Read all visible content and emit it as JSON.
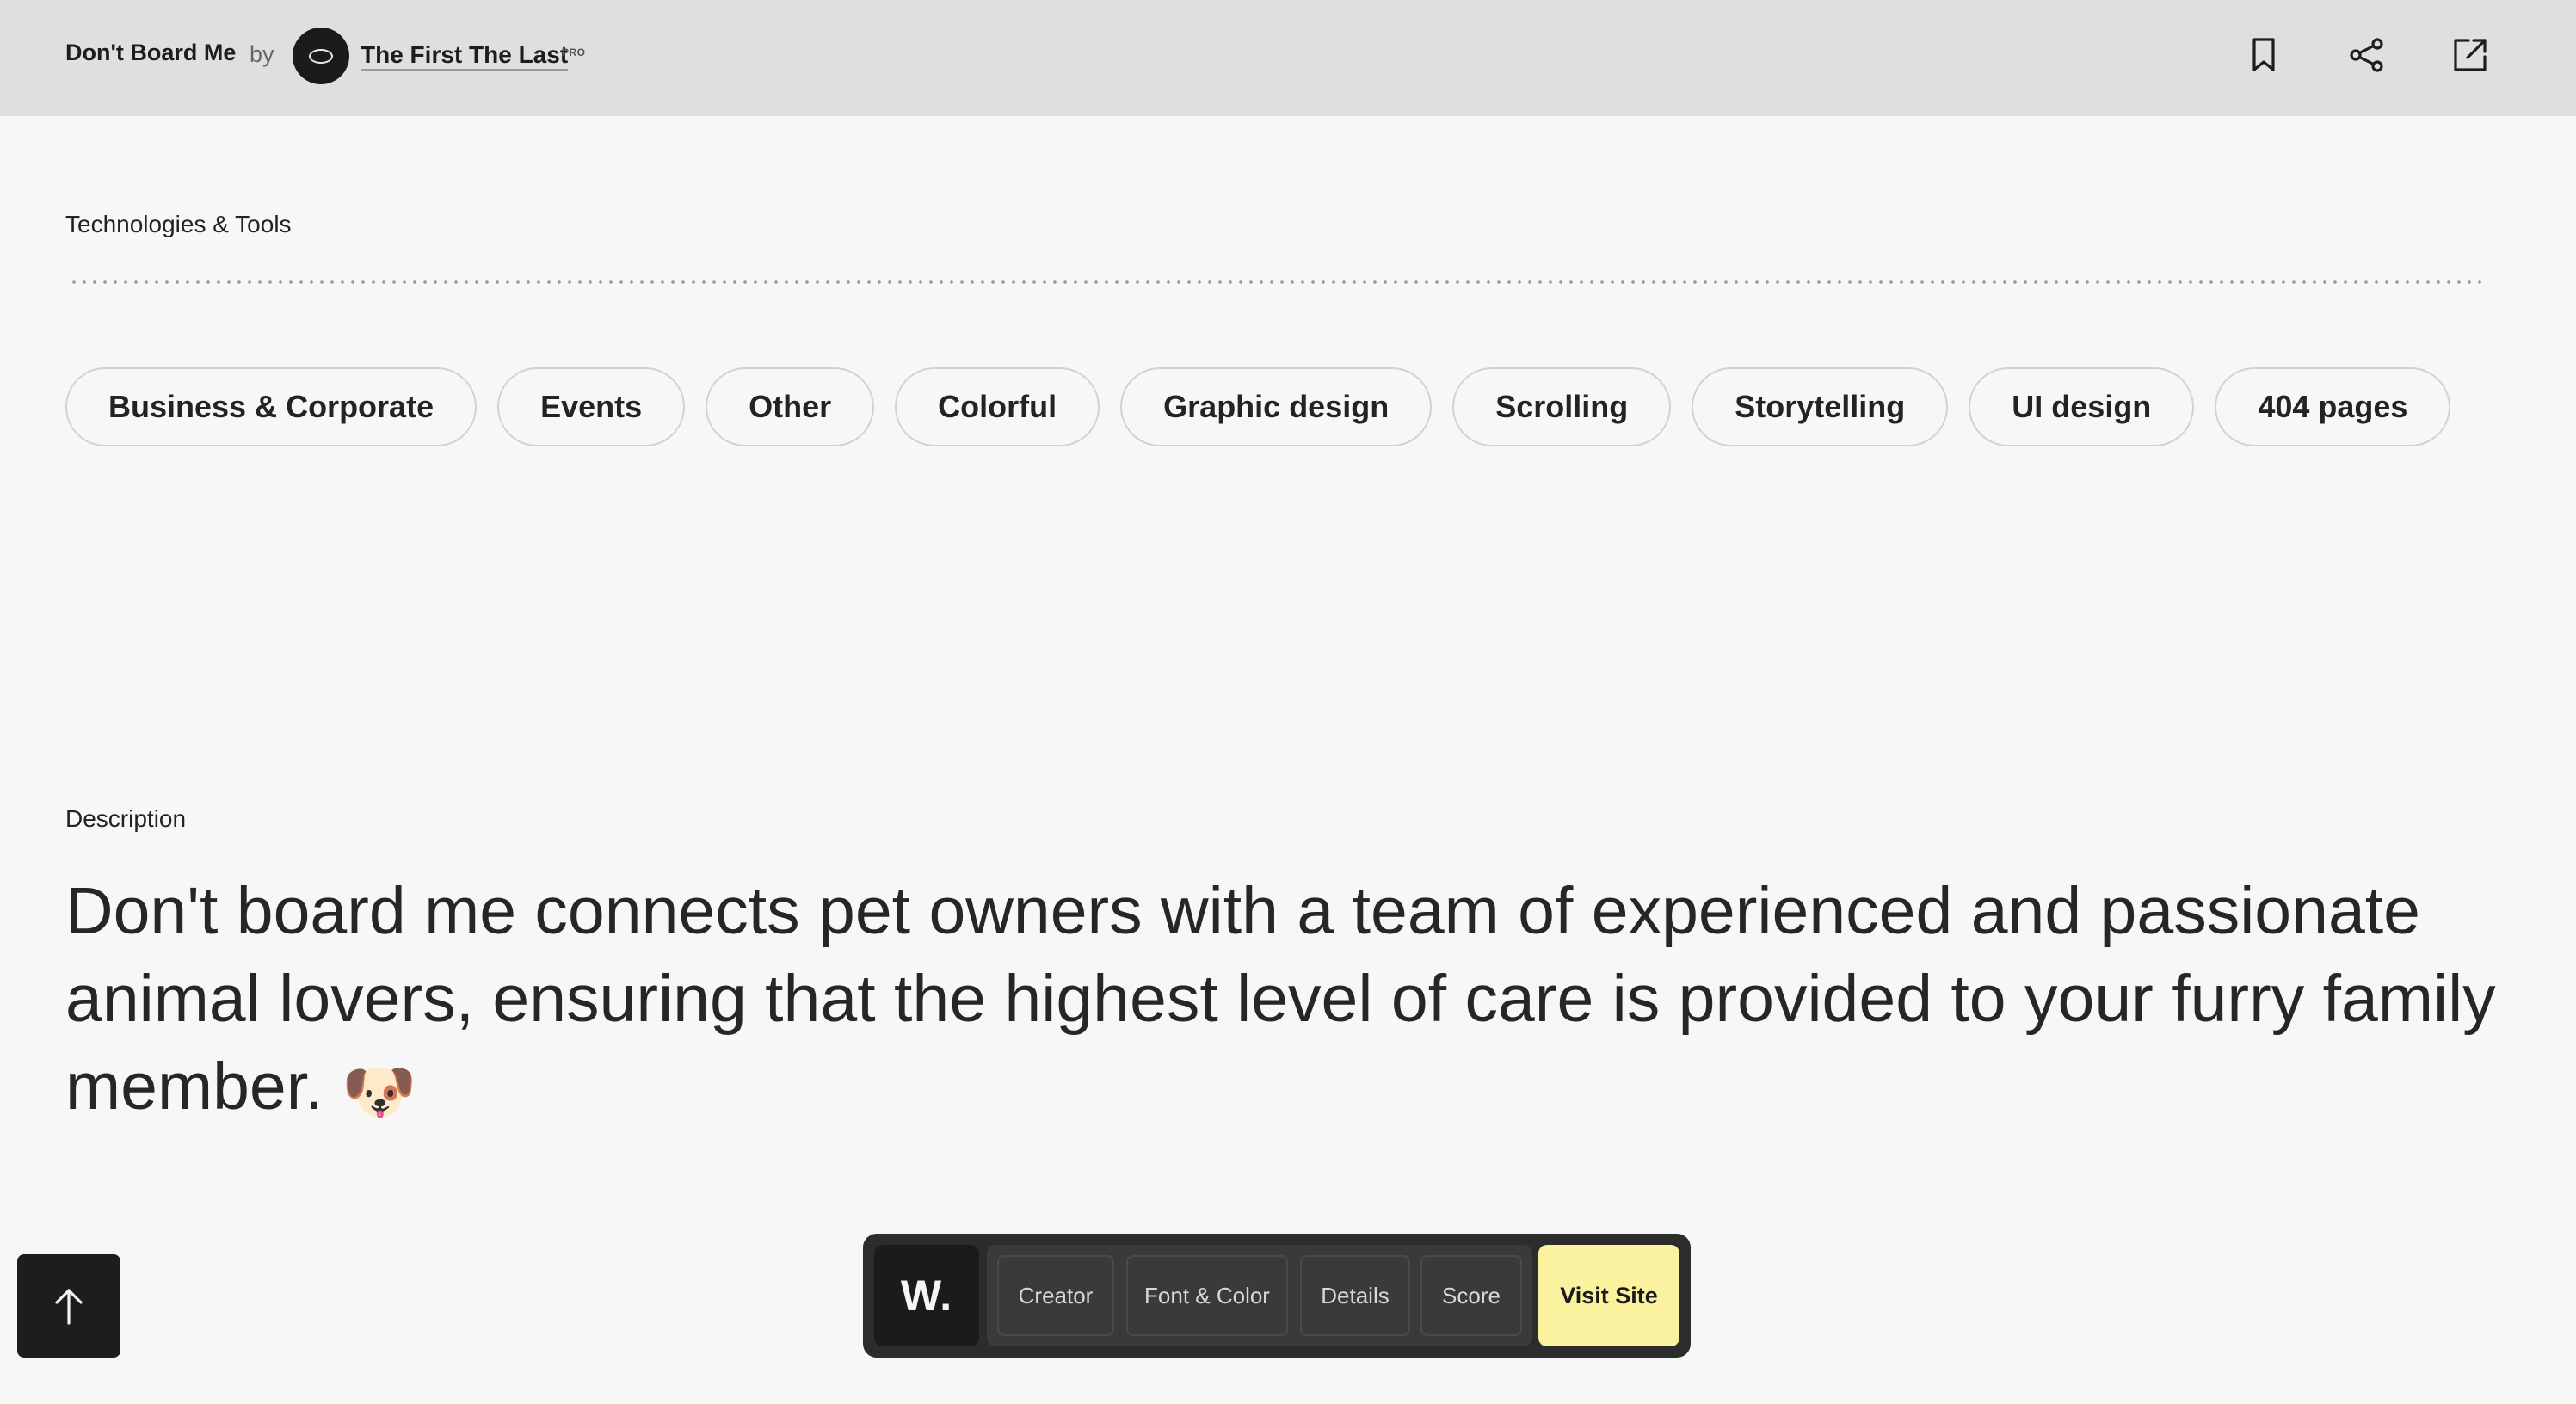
{
  "header": {
    "site_title": "Don't Board Me",
    "by": "by",
    "creator_name": "The First The Last",
    "creator_badge": "PRO",
    "icons": [
      "bookmark-icon",
      "share-icon",
      "external-link-icon"
    ]
  },
  "technologies": {
    "label": "Technologies & Tools",
    "tags": [
      "Business & Corporate",
      "Events",
      "Other",
      "Colorful",
      "Graphic design",
      "Scrolling",
      "Storytelling",
      "UI design",
      "404 pages"
    ]
  },
  "description": {
    "label": "Description",
    "text": "Don't board me connects pet owners with a team of experienced and passionate animal lovers, ensuring that the highest level of care is provided to your furry family member.",
    "emoji": "🐶"
  },
  "bottom_bar": {
    "logo": "W.",
    "nav": [
      "Creator",
      "Font & Color",
      "Details",
      "Score"
    ],
    "visit_label": "Visit Site"
  },
  "colors": {
    "header_bg": "#dfdfdf",
    "page_bg": "#f7f7f7",
    "visit_button": "#fbf2a0",
    "bar_bg": "#2c2c2c"
  }
}
